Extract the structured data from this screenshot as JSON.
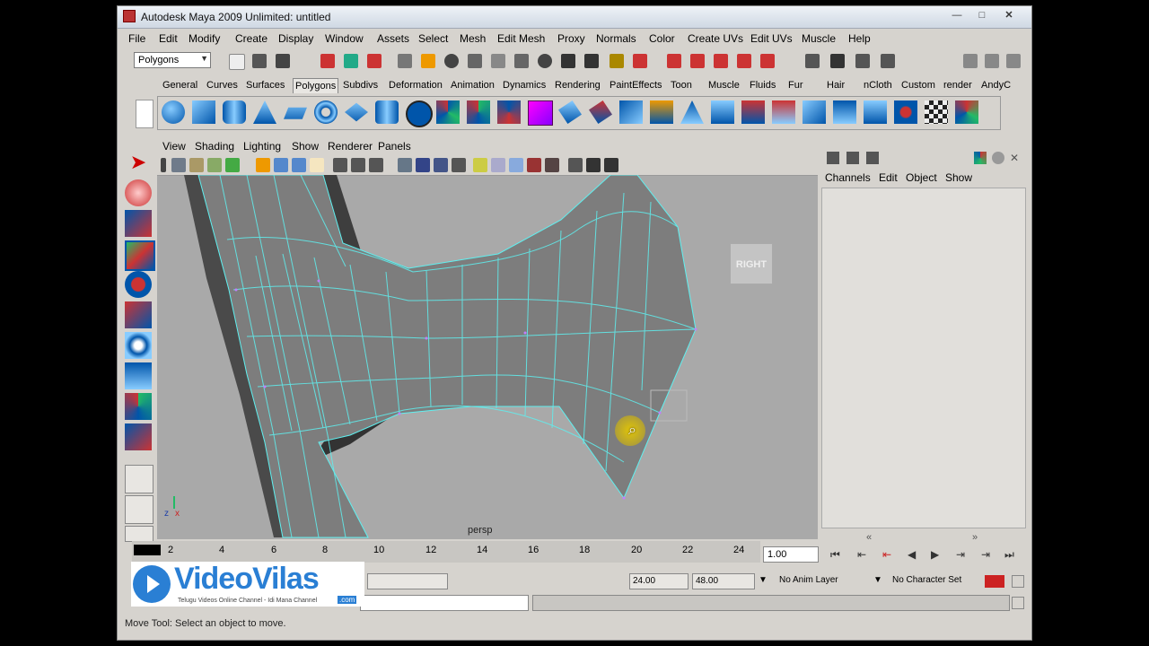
{
  "window": {
    "title": "Autodesk Maya 2009 Unlimited: untitled"
  },
  "menubar": [
    "File",
    "Edit",
    "Modify",
    "Create",
    "Display",
    "Window",
    "Assets",
    "Select",
    "Mesh",
    "Edit Mesh",
    "Proxy",
    "Normals",
    "Color",
    "Create UVs",
    "Edit UVs",
    "Muscle",
    "Help"
  ],
  "toolbar": {
    "mode_select": "Polygons"
  },
  "shelf_tabs": [
    "General",
    "Curves",
    "Surfaces",
    "Polygons",
    "Subdivs",
    "Deformation",
    "Animation",
    "Dynamics",
    "Rendering",
    "PaintEffects",
    "Toon",
    "Muscle",
    "Fluids",
    "Fur",
    "Hair",
    "nCloth",
    "Custom",
    "render",
    "AndyC"
  ],
  "shelf_active": "Polygons",
  "viewport": {
    "menu": [
      "View",
      "Shading",
      "Lighting",
      "Show",
      "Renderer",
      "Panels"
    ],
    "camera_label": "persp",
    "viewcube_label": "RIGHT",
    "axis_z": "z",
    "axis_x": "x"
  },
  "channel_box": {
    "menu": [
      "Channels",
      "Edit",
      "Object",
      "Show"
    ]
  },
  "timeline": {
    "ticks": [
      "2",
      "4",
      "6",
      "8",
      "10",
      "12",
      "14",
      "16",
      "18",
      "20",
      "22",
      "24"
    ],
    "current_frame": "1.00"
  },
  "range": {
    "start_time": "24.00",
    "end_time": "48.00",
    "anim_layer": "No Anim Layer",
    "character_set": "No Character Set"
  },
  "status": {
    "help_line": "Move Tool: Select an object to move."
  },
  "overlay": {
    "logo_text": "VideoVilas",
    "logo_tagline": "Telugu Videos Online Channel - Idi Mana Channel",
    "logo_domain": ".com"
  },
  "colors": {
    "ui_bg": "#d6d3ce",
    "viewport_bg": "#a9a9a9",
    "wire": "#5ff0f0",
    "mesh": "#7d7d7d",
    "accent": "#2a7fd4"
  }
}
